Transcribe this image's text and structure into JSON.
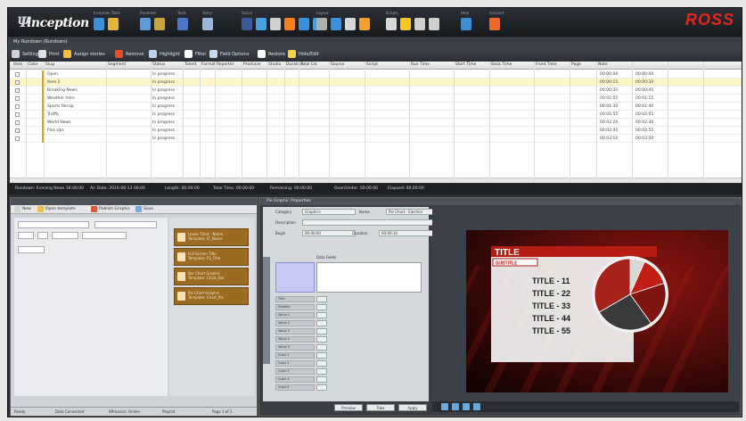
{
  "app": {
    "logo_text": "inception",
    "brand": "ROSS",
    "window_title": "My Rundown (Rundown)"
  },
  "toolbar_groups": [
    {
      "label": "Inception Tools",
      "icons": [
        "#3d8fd8",
        "#e2b53e"
      ]
    },
    {
      "label": "Rundown",
      "icons": [
        "#5f9ad6",
        "#c9a33b"
      ]
    },
    {
      "label": "Tools",
      "icons": [
        "#4a78c4"
      ]
    },
    {
      "label": "Story",
      "icons": [
        "#9eb7d8"
      ]
    },
    {
      "label": "Social",
      "icons": [
        "#3b5998",
        "#4a9fe0",
        "#d0d0d0",
        "#f48120",
        "#3d8fd8",
        "#3aa3e3"
      ]
    },
    {
      "label": "Layout",
      "icons": [
        "#b0b0b0",
        "#3d8fd8",
        "#d7d7d7",
        "#f0a030"
      ]
    },
    {
      "label": "Scripts",
      "icons": [
        "#d8d8d8",
        "#f3c622",
        "#cfcfcf",
        "#cfcfcf"
      ]
    },
    {
      "label": "Help",
      "icons": [
        "#3d8fd8"
      ]
    },
    {
      "label": "Account",
      "icons": [
        "#ec6a2b"
      ]
    }
  ],
  "rundown_toolbar": [
    {
      "label": "Settings",
      "icon": "gear-icon",
      "color": "#cfd3d8"
    },
    {
      "label": "Print",
      "icon": "print-icon",
      "color": "#e0e0e0"
    },
    {
      "label": "Assign stories",
      "icon": "assign-icon",
      "color": "#f2c13a"
    },
    {
      "label": "Remove",
      "icon": "remove-icon",
      "color": "#e34d2a"
    },
    {
      "label": "Highlight",
      "icon": "highlight-icon",
      "color": "#bcd6f0"
    },
    {
      "label": "Filter",
      "icon": "filter-icon",
      "color": "#ffffff"
    },
    {
      "label": "Field Options",
      "icon": "options-icon",
      "color": "#c7d8ec"
    },
    {
      "label": "Restore",
      "icon": "restore-icon",
      "color": "#ffffff"
    },
    {
      "label": "Hide/Edit",
      "icon": "hide-icon",
      "color": "#f4d24a"
    }
  ],
  "grid": {
    "columns": [
      "Item",
      "Color",
      "Slug",
      "Segment",
      "Status",
      "Talent",
      "Format",
      "Reporter",
      "Producer",
      "Studio",
      "Duration",
      "Total Est",
      "Source",
      "Script",
      "Run Time",
      "Start Time",
      "Back Time",
      "Front Time",
      "Page",
      "Note"
    ],
    "rows": [
      {
        "slug": "Open",
        "status": "In progress",
        "back_time": "00:00:00",
        "front_time": "00:00:00",
        "selected": false
      },
      {
        "slug": "Item 2",
        "status": "In progress",
        "back_time": "00:00:15",
        "front_time": "00:00:30",
        "selected": true
      },
      {
        "slug": "Breaking News",
        "status": "In progress",
        "back_time": "00:00:35",
        "front_time": "00:00:45",
        "selected": false
      },
      {
        "slug": "Weather Intro",
        "status": "In progress",
        "back_time": "00:01:05",
        "front_time": "00:01:15",
        "selected": false
      },
      {
        "slug": "Sports Recap",
        "status": "In progress",
        "back_time": "00:01:30",
        "front_time": "00:01:40",
        "selected": false
      },
      {
        "slug": "Traffic",
        "status": "In progress",
        "back_time": "00:01:55",
        "front_time": "00:02:05",
        "selected": false
      },
      {
        "slug": "World News",
        "status": "In progress",
        "back_time": "00:02:20",
        "front_time": "00:02:30",
        "selected": false
      },
      {
        "slug": "Pick Ups",
        "status": "In progress",
        "back_time": "00:02:45",
        "front_time": "00:02:55",
        "selected": false
      },
      {
        "slug": "",
        "status": "In progress",
        "back_time": "00:03:10",
        "front_time": "00:03:20",
        "selected": false
      }
    ]
  },
  "status_bar": [
    "Rundown: Evening News 18:00:00",
    "Air Date: 2016-06-13 00:00",
    "Length: 00:00:00",
    "Total Time: 00:00:00",
    "Remaining: 00:00:00",
    "Over/Under: 00:00:00",
    "Elapsed: 00:00:00"
  ],
  "bottom_left": {
    "toolbar": [
      "New",
      "Open template",
      "Publish Graphic",
      "Save"
    ],
    "templates": [
      {
        "line1": "Lower Third - Name",
        "line2": "Template: LT_Name"
      },
      {
        "line1": "Full Screen Title",
        "line2": "Template: FS_Title"
      },
      {
        "line1": "Bar Chart Graphic",
        "line2": "Template: Chart_Bar"
      },
      {
        "line1": "Pie Chart Graphic",
        "line2": "Template: Chart_Pie"
      }
    ],
    "status": [
      "Ready",
      "Data Connected",
      "XPression: Online",
      "Playlist",
      "Page 1 of 1"
    ]
  },
  "bottom_right": {
    "title": "Pie Graphic Properties",
    "fields": [
      {
        "label": "Category",
        "value": "Graphics"
      },
      {
        "label": "Name",
        "value": "Pie Chart - Election"
      },
      {
        "label": "Description",
        "value": ""
      },
      {
        "label": "Begin",
        "value": "00:00:00"
      },
      {
        "label": "Duration",
        "value": "00:00:10"
      }
    ],
    "section": "Data Fields",
    "vtab": "Field Editor",
    "row_labels": [
      "Title",
      "Subtitle",
      "Value 1",
      "Value 2",
      "Value 3",
      "Value 4",
      "Value 5",
      "Color 1",
      "Color 2",
      "Color 3",
      "Color 4",
      "Color 5"
    ],
    "buttons": [
      "Preview",
      "Take",
      "Apply"
    ]
  },
  "preview": {
    "title": "TITLE",
    "subtitle": "SUBTITLE",
    "items": [
      "TITLE - 11",
      "TITLE - 22",
      "TITLE - 33",
      "TITLE - 44",
      "TITLE - 55"
    ],
    "slices": [
      11,
      22,
      33,
      44,
      55
    ],
    "slice_colors": [
      "#d8d8d8",
      "#c01e16",
      "#7f1410",
      "#3a3a3a",
      "#a8221c"
    ]
  }
}
